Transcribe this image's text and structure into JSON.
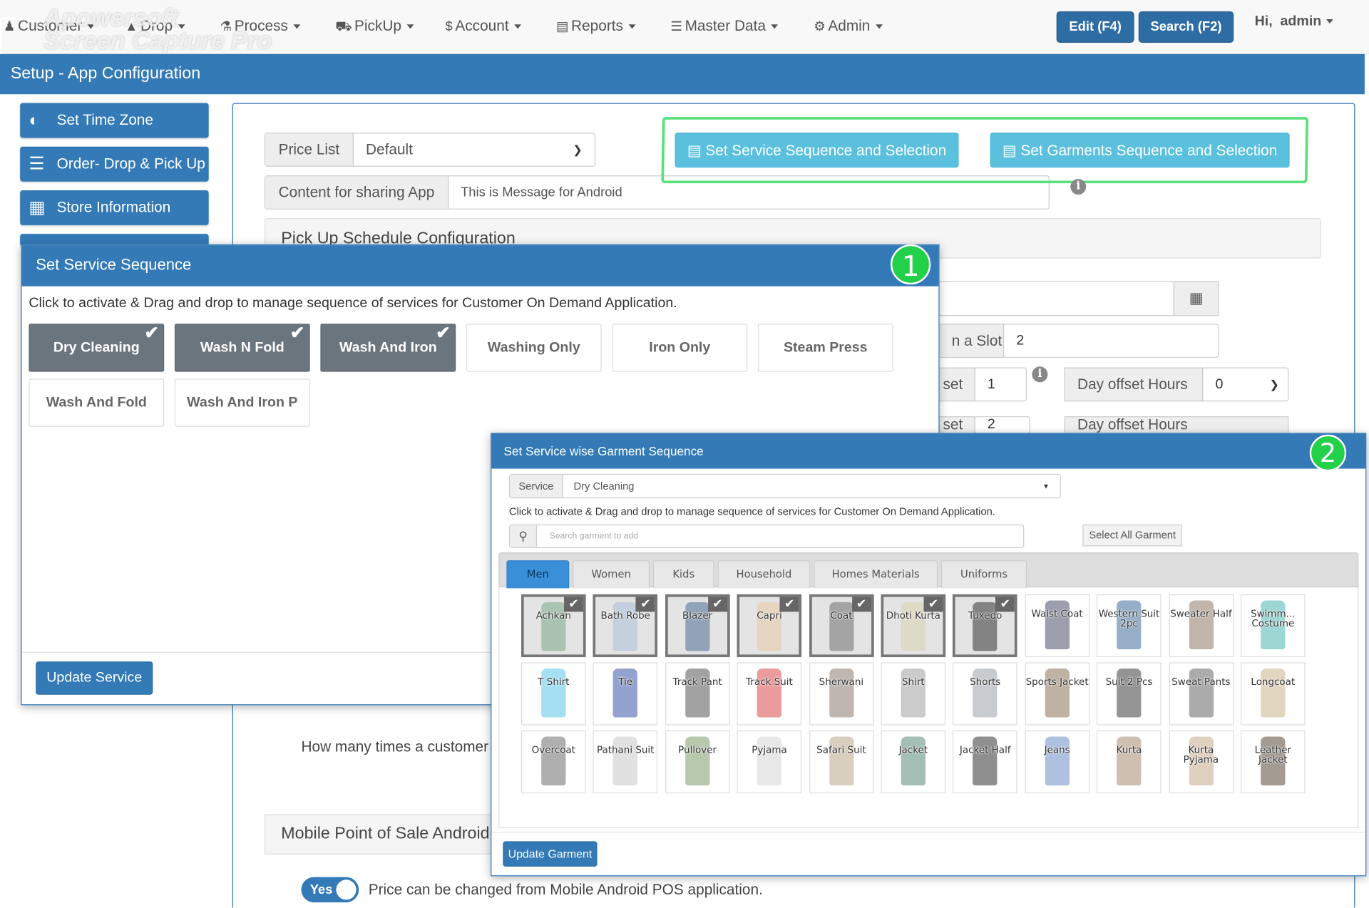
{
  "nav": {
    "items": [
      {
        "label": "Customer",
        "icon": "user-icon"
      },
      {
        "label": "Drop",
        "icon": "drop-icon"
      },
      {
        "label": "Process",
        "icon": "flask-icon"
      },
      {
        "label": "PickUp",
        "icon": "truck-icon"
      },
      {
        "label": "Account",
        "icon": "dollar-icon"
      },
      {
        "label": "Reports",
        "icon": "book-icon"
      },
      {
        "label": "Master Data",
        "icon": "database-icon"
      },
      {
        "label": "Admin",
        "icon": "gear-icon"
      }
    ],
    "edit_label": "Edit (F4)",
    "search_label": "Search (F2)",
    "greeting": "Hi,",
    "user": "admin"
  },
  "watermark": {
    "line1": "Apowersoft",
    "line2": "Screen Capture Pro"
  },
  "header": {
    "title": "Setup -  App Configuration"
  },
  "sidebar": {
    "items": [
      {
        "label": "Set Time Zone",
        "icon": "half-circle-icon"
      },
      {
        "label": "Order- Drop & Pick Up",
        "icon": "list-icon"
      },
      {
        "label": "Store Information",
        "icon": "building-icon"
      }
    ]
  },
  "config": {
    "price_list_label": "Price List",
    "price_list_value": "Default",
    "content_label": "Content for sharing App",
    "content_value": "This is Message for Android",
    "btn_service_seq": "Set Service Sequence and Selection",
    "btn_garment_seq": "Set Garments Sequence and Selection",
    "pickup_section": "Pick Up Schedule Configuration",
    "slot_label": "n a Slot",
    "slot_value": "2",
    "offset_label": "set",
    "offset_value": "1",
    "offset_value2": "2",
    "day_offset_label": "Day offset Hours",
    "day_offset_value": "0",
    "customer_question": "How many times a customer",
    "mpos_section": "Mobile Point of Sale Android",
    "toggle_label": "Yes",
    "toggle_desc": "Price can be changed from Mobile Android POS application."
  },
  "modal1": {
    "title": "Set Service Sequence",
    "badge": "1",
    "description": "Click to activate & Drag and drop to manage sequence of services for Customer On Demand Application.",
    "services": [
      {
        "label": "Dry Cleaning",
        "active": true
      },
      {
        "label": "Wash N Fold",
        "active": true
      },
      {
        "label": "Wash And Iron",
        "active": true
      },
      {
        "label": "Washing Only",
        "active": false
      },
      {
        "label": "Iron Only",
        "active": false
      },
      {
        "label": "Steam Press",
        "active": false
      },
      {
        "label": "Wash And Fold",
        "active": false
      },
      {
        "label": "Wash And Iron P",
        "active": false
      }
    ],
    "update_label": "Update Service"
  },
  "modal2": {
    "title": "Set Service wise Garment Sequence",
    "badge": "2",
    "service_label": "Service",
    "service_value": "Dry Cleaning",
    "description": "Click to activate & Drag and drop to manage sequence of services for Customer On Demand Application.",
    "search_placeholder": "Search garment to add",
    "select_all_label": "Select All Garment",
    "tabs": [
      {
        "label": "Men",
        "active": true
      },
      {
        "label": "Women",
        "active": false
      },
      {
        "label": "Kids",
        "active": false
      },
      {
        "label": "Household",
        "active": false
      },
      {
        "label": "Homes Materials",
        "active": false
      },
      {
        "label": "Uniforms",
        "active": false
      }
    ],
    "garments": [
      {
        "label": "Achkan",
        "active": true,
        "color": "#7aa886"
      },
      {
        "label": "Bath Robe",
        "active": true,
        "color": "#a9bfd9"
      },
      {
        "label": "Blazer",
        "active": true,
        "color": "#4f6d94"
      },
      {
        "label": "Capri",
        "active": true,
        "color": "#e8c8a4"
      },
      {
        "label": "Coat",
        "active": true,
        "color": "#6f6f6f"
      },
      {
        "label": "Dhoti Kurta",
        "active": true,
        "color": "#d9d2b0"
      },
      {
        "label": "Tuxedo",
        "active": true,
        "color": "#333333"
      },
      {
        "label": "Waist Coat",
        "active": false,
        "color": "#4a4f6a"
      },
      {
        "label": "Western Suit 2pc",
        "active": false,
        "color": "#3f6c99"
      },
      {
        "label": "Sweater Half",
        "active": false,
        "color": "#8f7a68"
      },
      {
        "label": "Swimm... Costume",
        "active": false,
        "color": "#4bb7b0"
      },
      {
        "label": "T Shirt",
        "active": false,
        "color": "#5bc6e8"
      },
      {
        "label": "Tie",
        "active": false,
        "color": "#3a56a8"
      },
      {
        "label": "Track Pant",
        "active": false,
        "color": "#555555"
      },
      {
        "label": "Track Suit",
        "active": false,
        "color": "#d94a4a"
      },
      {
        "label": "Sherwani",
        "active": false,
        "color": "#8a7a70"
      },
      {
        "label": "Shirt",
        "active": false,
        "color": "#a0a0a0"
      },
      {
        "label": "Shorts",
        "active": false,
        "color": "#9aa0a8"
      },
      {
        "label": "Sports Jacket",
        "active": false,
        "color": "#8a7256"
      },
      {
        "label": "Suit 2 Pcs",
        "active": false,
        "color": "#3d3d3d"
      },
      {
        "label": "Sweat Pants",
        "active": false,
        "color": "#666666"
      },
      {
        "label": "Longcoat",
        "active": false,
        "color": "#c9b48a"
      },
      {
        "label": "Overcoat",
        "active": false,
        "color": "#6d6d6d"
      },
      {
        "label": "Pathani Suit",
        "active": false,
        "color": "#c9c9c9"
      },
      {
        "label": "Pullover",
        "active": false,
        "color": "#7c9a6a"
      },
      {
        "label": "Pyjama",
        "active": false,
        "color": "#d6d6d6"
      },
      {
        "label": "Safari Suit",
        "active": false,
        "color": "#b8a88a"
      },
      {
        "label": "Jacket",
        "active": false,
        "color": "#5a8a7a"
      },
      {
        "label": "Jacket Half",
        "active": false,
        "color": "#333333"
      },
      {
        "label": "Jeans",
        "active": false,
        "color": "#6b8ec2"
      },
      {
        "label": "Kurta",
        "active": false,
        "color": "#a58a70"
      },
      {
        "label": "Kurta Pyjama",
        "active": false,
        "color": "#c7a98c"
      },
      {
        "label": "Leather Jacket",
        "active": false,
        "color": "#5a4a3a"
      }
    ],
    "update_label": "Update Garment"
  }
}
